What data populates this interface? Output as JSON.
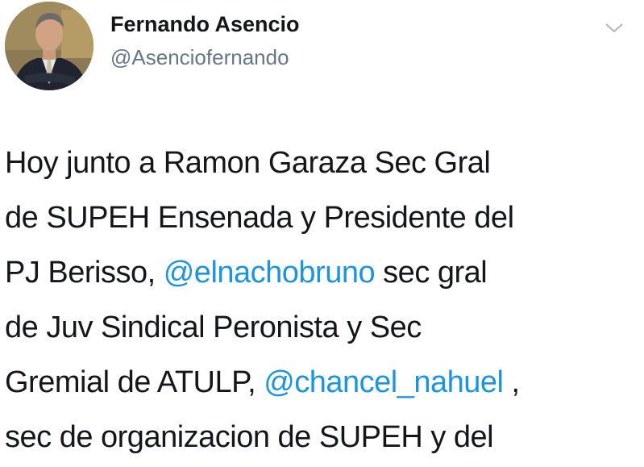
{
  "tweet": {
    "author": {
      "name": "Fernando Asencio",
      "handle": "@Asenciofernando",
      "avatar_icon": "profile-photo"
    },
    "menu_icon": "chevron-down-icon",
    "text": {
      "line1": "Hoy junto a Ramon Garaza Sec Gral",
      "line2": "de SUPEH Ensenada y Presidente del",
      "line3_prefix": "PJ Berisso, ",
      "line3_mention": "@elnachobruno",
      "line3_suffix": " sec gral",
      "line4": "de Juv Sindical Peronista y Sec",
      "line5_prefix": "Gremial de ATULP, ",
      "line5_mention": "@chancel_nahuel",
      "line5_suffix": " ,",
      "line6": "sec de organizacion de SUPEH y del"
    },
    "colors": {
      "text": "#14171a",
      "handle": "#657786",
      "mention": "#1b95e0"
    }
  }
}
